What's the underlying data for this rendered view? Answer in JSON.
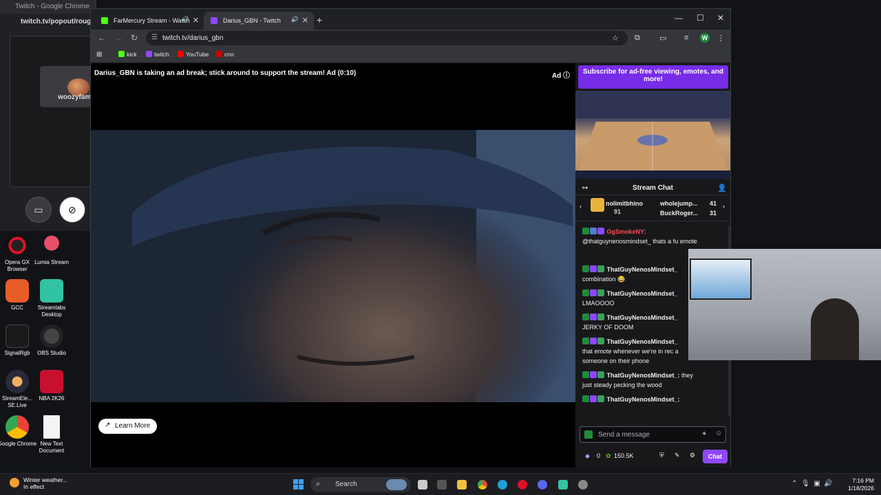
{
  "bg_window": {
    "title": "Twitch - Google Chrome",
    "url": "twitch.tv/popout/rough_",
    "streamer_label": "woozyfam"
  },
  "desktop_icons": [
    {
      "label": "Opera GX Browser"
    },
    {
      "label": "Lumia Stream"
    },
    {
      "label": "GCC"
    },
    {
      "label": "Streamlabs Desktop"
    },
    {
      "label": "SignalRgb"
    },
    {
      "label": "OBS Studio"
    },
    {
      "label": "StreamEle... SE.Live"
    },
    {
      "label": "NBA 2K26"
    },
    {
      "label": "Google Chrome"
    },
    {
      "label": "New Text Document"
    }
  ],
  "tabs": [
    {
      "label": "FarMercury Stream - Watch",
      "active": false,
      "color": "#53fc18"
    },
    {
      "label": "Darius_GBN - Twitch",
      "active": true,
      "color": "#9147ff"
    }
  ],
  "address": {
    "url": "twitch.tv/darius_gbn"
  },
  "bookmarks": [
    {
      "label": "kick",
      "color": "#53fc18"
    },
    {
      "label": "twitch",
      "color": "#9147ff"
    },
    {
      "label": "YouTube",
      "color": "#ff0000"
    },
    {
      "label": "cnn",
      "color": "#cc0000"
    }
  ],
  "player": {
    "ad_message": "Darius_GBN is taking an ad break; stick around to support the stream! Ad (0:10)",
    "ad_badge": "Ad",
    "learn_more": "Learn More"
  },
  "sidebar": {
    "subscribe_banner": "Subscribe for ad-free viewing, emotes, and more!",
    "chat_title": "Stream Chat",
    "gifters": [
      {
        "name": "nolimitbhino",
        "count": "91"
      },
      {
        "name": "wholejump...",
        "count": "41"
      },
      {
        "name": "BuckRoger...",
        "count": "31"
      }
    ],
    "messages": [
      {
        "user": "OgSmokeNY",
        "user_color": "#ff4d4d",
        "text": "@thatguynenosmindset_ thats a fu emote"
      },
      {
        "user": "ThatGuyNenosMindset_",
        "user_color": "#ffffff",
        "text": "combination 😂"
      },
      {
        "user": "ThatGuyNenosMindset_",
        "user_color": "#ffffff",
        "text": "LMAOOOO"
      },
      {
        "user": "ThatGuyNenosMindset_",
        "user_color": "#ffffff",
        "text": "JERKY OF DOOM"
      },
      {
        "user": "ThatGuyNenosMindset_",
        "user_color": "#ffffff",
        "text": "that emote whenever we're in rec a someone on their phone"
      },
      {
        "user": "ThatGuyNenosMindset_:",
        "user_color": "#ffffff",
        "text": "they just steady pecking the wood"
      },
      {
        "user": "ThatGuyNenosMindset_:",
        "user_color": "#ffffff",
        "text": ""
      }
    ],
    "input_placeholder": "Send a message",
    "points_left": "0",
    "points_right": "150.5K",
    "chat_button": "Chat"
  },
  "taskbar": {
    "weather_line1": "Winter weather...",
    "weather_line2": "In effect",
    "search_placeholder": "Search",
    "time": "7:16 PM",
    "date": "1/18/2026"
  }
}
